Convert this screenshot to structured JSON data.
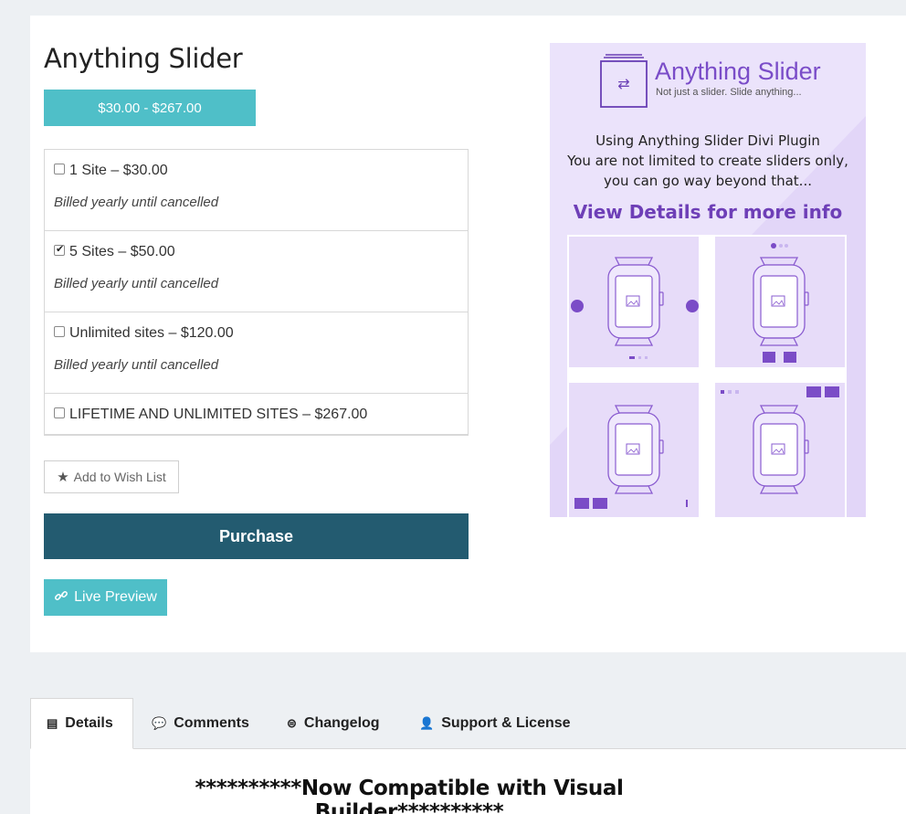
{
  "product": {
    "title": "Anything Slider",
    "price_range": "$30.00 - $267.00"
  },
  "options": [
    {
      "label": "1 Site – $30.00",
      "checked": false,
      "billing": "Billed yearly until cancelled"
    },
    {
      "label": "5 Sites – $50.00",
      "checked": true,
      "billing": "Billed yearly until cancelled"
    },
    {
      "label": "Unlimited sites – $120.00",
      "checked": false,
      "billing": "Billed yearly until cancelled"
    },
    {
      "label": "LIFETIME AND UNLIMITED SITES – $267.00",
      "checked": false,
      "billing": ""
    }
  ],
  "actions": {
    "wishlist_label": "Add to Wish List",
    "purchase_label": "Purchase",
    "live_preview_label": "Live Preview"
  },
  "promo": {
    "brand": "Anything Slider",
    "tagline": "Not just a slider. Slide anything...",
    "line1": "Using Anything Slider Divi Plugin",
    "line2": "You are not limited to create sliders only,",
    "line3": "you can go way beyond that...",
    "cta": "View Details for more info",
    "accent_color": "#7a4cc8"
  },
  "tabs": [
    {
      "label": "Details",
      "icon": "document-icon",
      "active": true
    },
    {
      "label": "Comments",
      "icon": "comments-icon",
      "active": false
    },
    {
      "label": "Changelog",
      "icon": "changelog-icon",
      "active": false
    },
    {
      "label": "Support & License",
      "icon": "support-icon",
      "active": false
    }
  ],
  "content": {
    "headline": "**********Now Compatible with Visual Builder**********"
  },
  "colors": {
    "teal": "#4fbfc8",
    "navy": "#235b70"
  }
}
